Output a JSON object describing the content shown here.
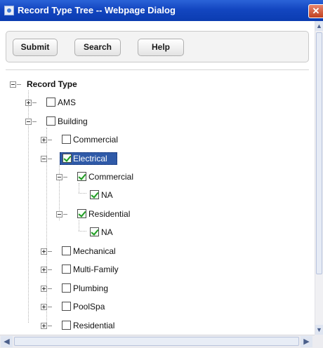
{
  "window": {
    "title": "Record Type Tree -- Webpage Dialog",
    "close_glyph": "✕"
  },
  "toolbar": {
    "submit_label": "Submit",
    "search_label": "Search",
    "help_label": "Help"
  },
  "tree": {
    "root": {
      "label": "Record Type",
      "expanded": true
    },
    "items": [
      {
        "label": "AMS",
        "checked": false,
        "expanded": false
      },
      {
        "label": "Building",
        "checked": false,
        "expanded": true
      },
      {
        "label": "Commercial",
        "checked": false,
        "expanded": false
      },
      {
        "label": "Electrical",
        "checked": true,
        "expanded": true,
        "selected": true
      },
      {
        "label": "Commercial",
        "checked": true,
        "expanded": true
      },
      {
        "label": "NA",
        "checked": true
      },
      {
        "label": "Residential",
        "checked": true,
        "expanded": true
      },
      {
        "label": "NA",
        "checked": true
      },
      {
        "label": "Mechanical",
        "checked": false,
        "expanded": false
      },
      {
        "label": "Multi-Family",
        "checked": false,
        "expanded": false
      },
      {
        "label": "Plumbing",
        "checked": false,
        "expanded": false
      },
      {
        "label": "PoolSpa",
        "checked": false,
        "expanded": false
      },
      {
        "label": "Residential",
        "checked": false,
        "expanded": false
      }
    ]
  },
  "scrollbars": {
    "up_glyph": "▲",
    "down_glyph": "▼",
    "left_glyph": "◀",
    "right_glyph": "▶"
  },
  "colors": {
    "titlebar": "#0b3cb1",
    "selection": "#2f5aa8",
    "checkmark": "#1d9a20"
  }
}
